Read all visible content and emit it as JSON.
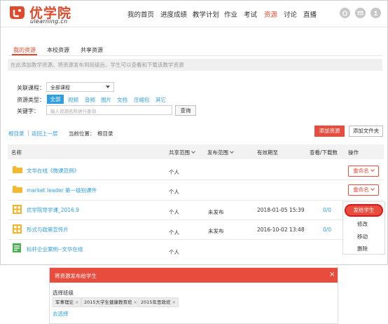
{
  "brand": {
    "name": "优学院",
    "domain": "ulearning.cn",
    "accent": "#e04a2c",
    "link": "#2e9ee0"
  },
  "nav": {
    "items": [
      "我的首页",
      "进度成绩",
      "教学计划",
      "作业",
      "考试",
      "资源",
      "讨论",
      "直播"
    ],
    "active_index": 5
  },
  "header_icons": [
    "home-icon",
    "mail-icon",
    "user-icon"
  ],
  "tabs": {
    "items": [
      "我的资源",
      "本校资源",
      "共享资源"
    ],
    "active_index": 0
  },
  "notice": "在此添加教学资源。将资源发布到班级后，学生可以查看和下载该教学资源",
  "filters": {
    "course_label": "关联课程：",
    "course_value": "全部课程",
    "type_label": "资源类型：",
    "types": [
      "全部",
      "视频",
      "音频",
      "图片",
      "文档",
      "压缩包",
      "其它"
    ],
    "type_active_index": 0,
    "keyword_label": "关键字：",
    "keyword_placeholder": "输入资源名称进行查询",
    "search_label": "查询"
  },
  "breadcrumb": {
    "root": "根目录",
    "sep": "|",
    "up": "返回上一层",
    "location_label": "当前位置：",
    "location_value": "根目录"
  },
  "toolbar": {
    "add_resource": "添加资源",
    "add_folder": "添加文件夹"
  },
  "table": {
    "headers": {
      "name": "名称",
      "share": "共享范围",
      "publish": "发布范围",
      "valid": "有效期至",
      "views": "查看/下载数",
      "ops": "操作"
    },
    "rows": [
      {
        "icon": "folder-icon",
        "name": "文华在线《微课范例》",
        "share": "个人",
        "publish": "",
        "valid": "",
        "views": "",
        "action": "重命名"
      },
      {
        "icon": "folder-icon",
        "name": "market leader 第一级别课件",
        "share": "个人",
        "publish": "",
        "valid": "",
        "views": "",
        "action": "重命名"
      },
      {
        "icon": "courseware-icon",
        "name": "优学院导学课_2016.9",
        "share": "个人",
        "publish": "未发布",
        "valid": "2018-01-05 15:39",
        "views": "0/0",
        "action": ""
      },
      {
        "icon": "courseware-icon",
        "name": "形式与政策宣传片",
        "share": "个人",
        "publish": "未发布",
        "valid": "2016-10-02 13:48",
        "views": "0/0",
        "action": ""
      },
      {
        "icon": "document-icon",
        "name": "标杆企业案例--文华在线",
        "share": "个人",
        "publish": "",
        "valid": "",
        "views": "",
        "action": ""
      }
    ]
  },
  "popup_menu": {
    "items": [
      "发给学生",
      "修改",
      "移动",
      "删除"
    ]
  },
  "dialog": {
    "title": "将资源发布给学生",
    "close": "×",
    "select_label": "选择班级",
    "chips": [
      "军事理论",
      "2015大学生健康教育班",
      "2015年思政班"
    ],
    "remove_label": "去选择"
  }
}
